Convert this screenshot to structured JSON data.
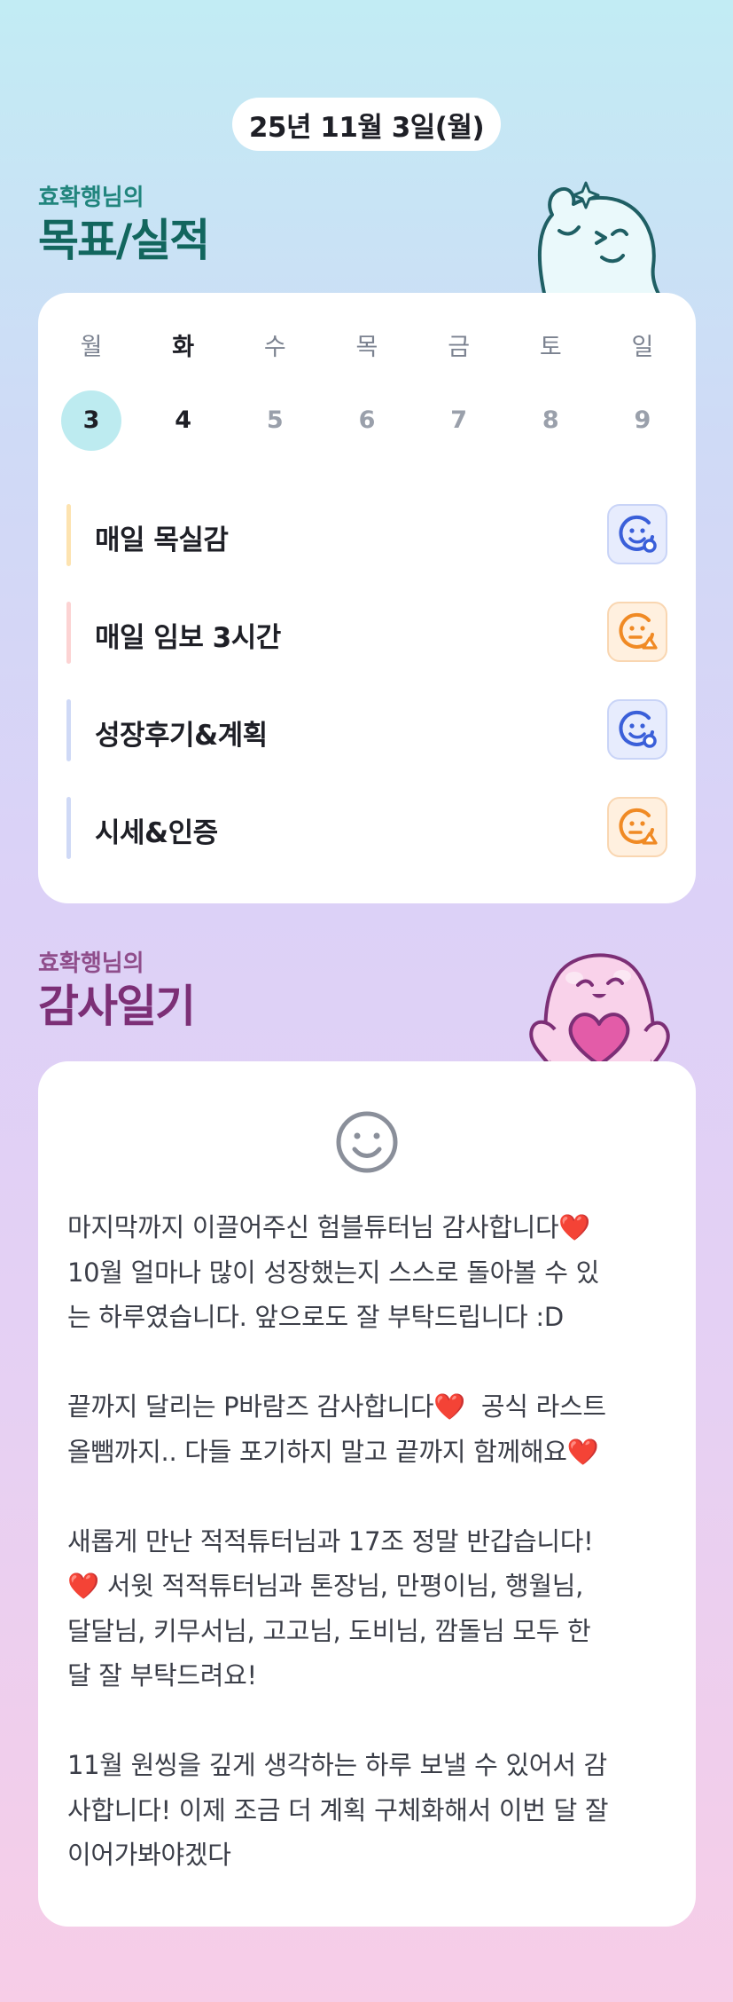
{
  "header": {
    "date": "25년 11월 3일(월)"
  },
  "goals_section": {
    "owner": "효확행님의",
    "title": "목표/실적",
    "weekdays": [
      "월",
      "화",
      "수",
      "목",
      "금",
      "토",
      "일"
    ],
    "dates": [
      "3",
      "4",
      "5",
      "6",
      "7",
      "8",
      "9"
    ],
    "selected_index": 0,
    "items": [
      {
        "label": "매일 목실감",
        "bar_color": "#fde3b0",
        "status": "blue-smile-icon"
      },
      {
        "label": "매일 임보 3시간",
        "bar_color": "#fcd3d3",
        "status": "orange-warning-smile-icon"
      },
      {
        "label": "성장후기&계획",
        "bar_color": "#cfd9f6",
        "status": "blue-smile-icon"
      },
      {
        "label": "시세&인증",
        "bar_color": "#cfd9f6",
        "status": "orange-warning-smile-icon"
      }
    ]
  },
  "diary_section": {
    "owner": "효확행님의",
    "title": "감사일기",
    "paragraphs": [
      "마지막까지 이끌어주신 험블튜터님 감사합니다❤️\n10월 얼마나 많이 성장했는지 스스로 돌아볼 수 있\n는 하루였습니다. 앞으로도 잘 부탁드립니다 :D",
      "끝까지 달리는 P바람즈 감사합니다❤️  공식 라스트\n올뺌까지.. 다들 포기하지 말고 끝까지 함께해요❤️",
      "새롭게 만난 적적튜터님과 17조 정말 반갑습니다!\n❤️ 서윗 적적튜터님과 톤장님, 만평이님, 행월님,\n달달님, 키무서님, 고고님, 도비님, 깜돌님 모두 한\n달 잘 부탁드려요!",
      "11월 원씽을 깊게 생각하는 하루 보낼 수 있어서 감\n사합니다! 이제 조금 더 계획 구체화해서 이번 달 잘\n이어가봐야겠다"
    ]
  },
  "colors": {
    "teal": "#12665e",
    "purple": "#7c2f76",
    "selected_date": "#bdebf0"
  }
}
